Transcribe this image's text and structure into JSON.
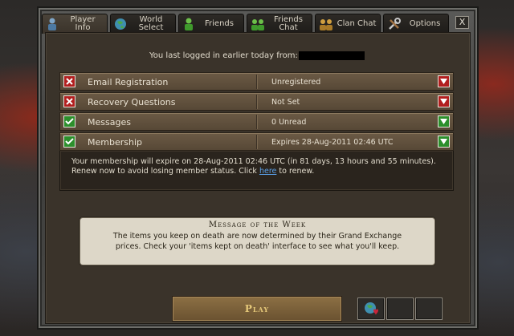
{
  "tabs": [
    {
      "label": "Player Info",
      "icon": "player-icon",
      "active": true
    },
    {
      "label": "World Select",
      "icon": "globe-icon",
      "active": false
    },
    {
      "label": "Friends",
      "icon": "friend-icon",
      "active": false
    },
    {
      "label": "Friends Chat",
      "icon": "friends-chat-icon",
      "active": false
    },
    {
      "label": "Clan Chat",
      "icon": "clan-icon",
      "active": false
    },
    {
      "label": "Options",
      "icon": "tools-icon",
      "active": false
    }
  ],
  "close_label": "X",
  "login_text": "You last logged in earlier today from:",
  "rows": [
    {
      "name": "Email Registration",
      "value": "Unregistered",
      "status": "bad"
    },
    {
      "name": "Recovery Questions",
      "value": "Not Set",
      "status": "bad"
    },
    {
      "name": "Messages",
      "value": "0 Unread",
      "status": "good"
    },
    {
      "name": "Membership",
      "value": "Expires 28-Aug-2011 02:46 UTC",
      "status": "good"
    }
  ],
  "membership_detail": {
    "text_before": "Your membership will expire on 28-Aug-2011 02:46 UTC (in 81 days, 13 hours and 55 minutes). Renew now to avoid losing member status. Click ",
    "link": "here",
    "text_after": " to renew."
  },
  "message_of_week": {
    "title": "Message of the Week",
    "body": "The items you keep on death are now determined by their Grand Exchange prices. Check your 'items kept on death' interface to see what you'll keep."
  },
  "play_label": "Play",
  "colors": {
    "bad": "#b21f1f",
    "good": "#2c8f2c",
    "link": "#5aa0e8"
  }
}
